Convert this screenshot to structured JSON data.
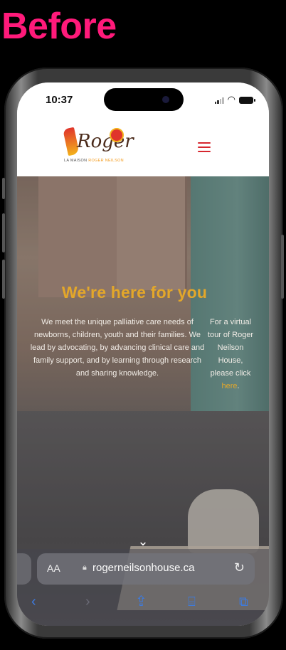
{
  "heading": {
    "text": "Before",
    "color": "#ff1a7a"
  },
  "status_bar": {
    "time": "10:37"
  },
  "site": {
    "logo": {
      "script_text": "Roger",
      "subtitle_a": "LA MAISON",
      "subtitle_b": "ROGER NEILSON"
    },
    "menu_icon": "hamburger-menu-icon"
  },
  "hero": {
    "title": "We're here for you",
    "body": "We meet the unique palliative care needs of newborns, children, youth and their families. We lead by advocating, by advancing clinical care and family support, and by learning through research and sharing knowledge.",
    "side_text": "For a virtual tour of Roger Neilson House, please click",
    "side_link": "here",
    "side_end": ".",
    "scroll_icon": "chevron-down-icon"
  },
  "browser": {
    "aa_label": "AA",
    "url": "rogerneilsonhouse.ca",
    "toolbar": {
      "back_icon": "chevron-left-icon",
      "forward_icon": "chevron-right-icon",
      "share_icon": "share-icon",
      "bookmarks_icon": "book-icon",
      "tabs_icon": "tabs-icon"
    }
  },
  "colors": {
    "accent_gold": "#e3a72a",
    "menu_red": "#d6272f",
    "ios_blue": "#3d7be0"
  }
}
